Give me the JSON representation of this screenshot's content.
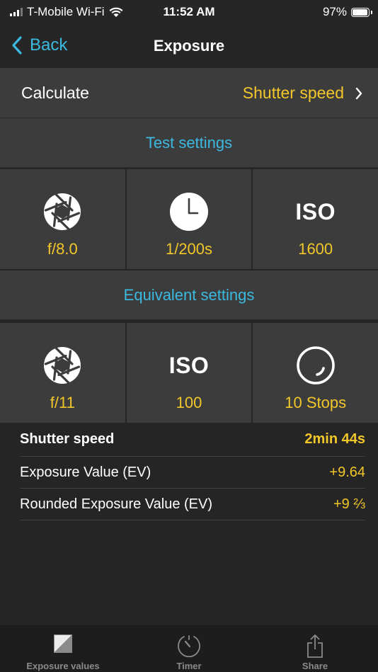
{
  "status_bar": {
    "carrier": "T-Mobile Wi-Fi",
    "time": "11:52 AM",
    "battery": "97%",
    "battery_level": 0.97
  },
  "nav": {
    "back_label": "Back",
    "title": "Exposure"
  },
  "calculate": {
    "label": "Calculate",
    "value": "Shutter speed"
  },
  "test_settings": {
    "header": "Test settings",
    "cells": [
      {
        "icon": "aperture-icon",
        "value": "f/8.0"
      },
      {
        "icon": "clock-icon",
        "value": "1/200s"
      },
      {
        "icon": "iso-icon",
        "icon_text": "ISO",
        "value": "1600"
      }
    ]
  },
  "equivalent_settings": {
    "header": "Equivalent settings",
    "cells": [
      {
        "icon": "aperture-icon",
        "value": "f/11"
      },
      {
        "icon": "iso-icon",
        "icon_text": "ISO",
        "value": "100"
      },
      {
        "icon": "nd-filter-icon",
        "value": "10 Stops"
      }
    ]
  },
  "results": [
    {
      "label": "Shutter speed",
      "value": "2min 44s"
    },
    {
      "label": "Exposure Value (EV)",
      "value": "+9.64"
    },
    {
      "label": "Rounded Exposure Value (EV)",
      "value": "+9 ⅔"
    }
  ],
  "tab_bar": {
    "tabs": [
      {
        "icon": "exposure-values-icon",
        "label": "Exposure values"
      },
      {
        "icon": "timer-icon",
        "label": "Timer"
      },
      {
        "icon": "share-icon",
        "label": "Share"
      }
    ]
  },
  "colors": {
    "accent_blue": "#3bb9e0",
    "value_yellow": "#f2c72a",
    "background": "#252525",
    "cell_background": "#3c3c3c"
  }
}
